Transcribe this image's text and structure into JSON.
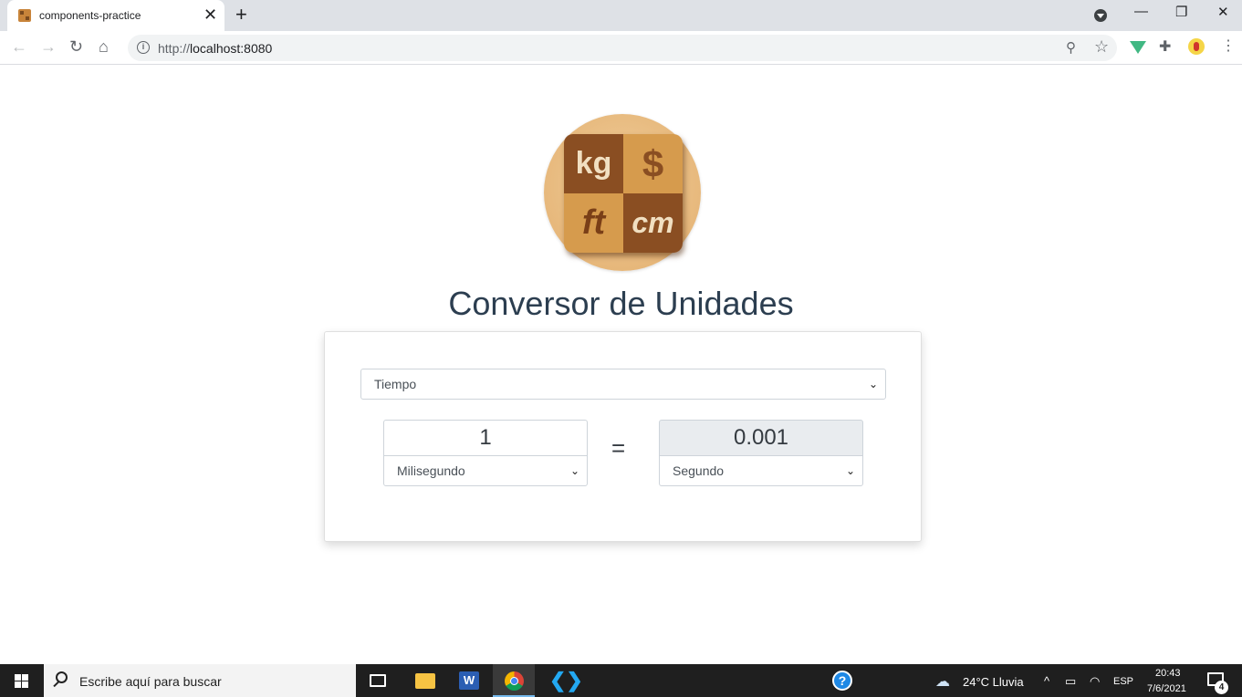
{
  "browser": {
    "tab_title": "components-practice",
    "tab_close": "✕",
    "new_tab": "+",
    "url_scheme": "http://",
    "url_host": "localhost:8080",
    "controls": {
      "minimize": "—",
      "restore": "❐",
      "close": "✕"
    }
  },
  "app": {
    "logo_cells": [
      "kg",
      "$",
      "ft",
      "cm"
    ],
    "title": "Conversor de Unidades",
    "category_select": "Tiempo",
    "from": {
      "value": "1",
      "unit": "Milisegundo"
    },
    "equals": "=",
    "to": {
      "value": "0.001",
      "unit": "Segundo"
    }
  },
  "taskbar": {
    "search_placeholder": "Escribe aquí para buscar",
    "word_letter": "W",
    "help": "?",
    "weather": "24°C  Lluvia",
    "language": "ESP",
    "time": "20:43",
    "date": "7/6/2021",
    "notifications": "4"
  }
}
